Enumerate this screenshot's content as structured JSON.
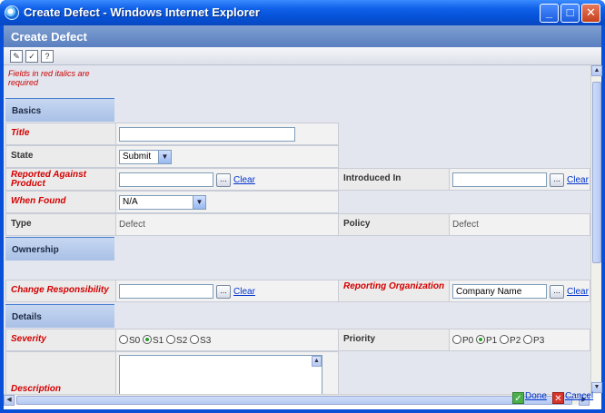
{
  "window": {
    "title": "Create Defect - Windows Internet Explorer"
  },
  "header": {
    "title": "Create Defect"
  },
  "note": "Fields in red italics are required",
  "sections": {
    "basics": "Basics",
    "ownership": "Ownership",
    "details": "Details"
  },
  "fields": {
    "title": {
      "label": "Title",
      "value": ""
    },
    "state": {
      "label": "State",
      "value": "Submit"
    },
    "reported_against": {
      "label": "Reported Against Product",
      "value": "",
      "clear": "Clear"
    },
    "introduced_in": {
      "label": "Introduced In",
      "value": "",
      "clear": "Clear"
    },
    "when_found": {
      "label": "When Found",
      "value": "N/A"
    },
    "type": {
      "label": "Type",
      "value": "Defect"
    },
    "policy": {
      "label": "Policy",
      "value": "Defect"
    },
    "change_responsibility": {
      "label": "Change Responsibility",
      "value": "",
      "clear": "Clear"
    },
    "reporting_org": {
      "label": "Reporting Organization",
      "value": "Company Name",
      "clear": "Clear"
    },
    "severity": {
      "label": "Severity",
      "options": [
        "S0",
        "S1",
        "S2",
        "S3"
      ],
      "selected": "S1"
    },
    "priority": {
      "label": "Priority",
      "options": [
        "P0",
        "P1",
        "P2",
        "P3"
      ],
      "selected": "P1"
    },
    "description": {
      "label": "Description",
      "value": ""
    }
  },
  "buttons": {
    "browse": "...",
    "done": "Done",
    "cancel": "Cancel"
  },
  "icons": [
    "edit-icon",
    "spellcheck-icon",
    "help-icon"
  ]
}
